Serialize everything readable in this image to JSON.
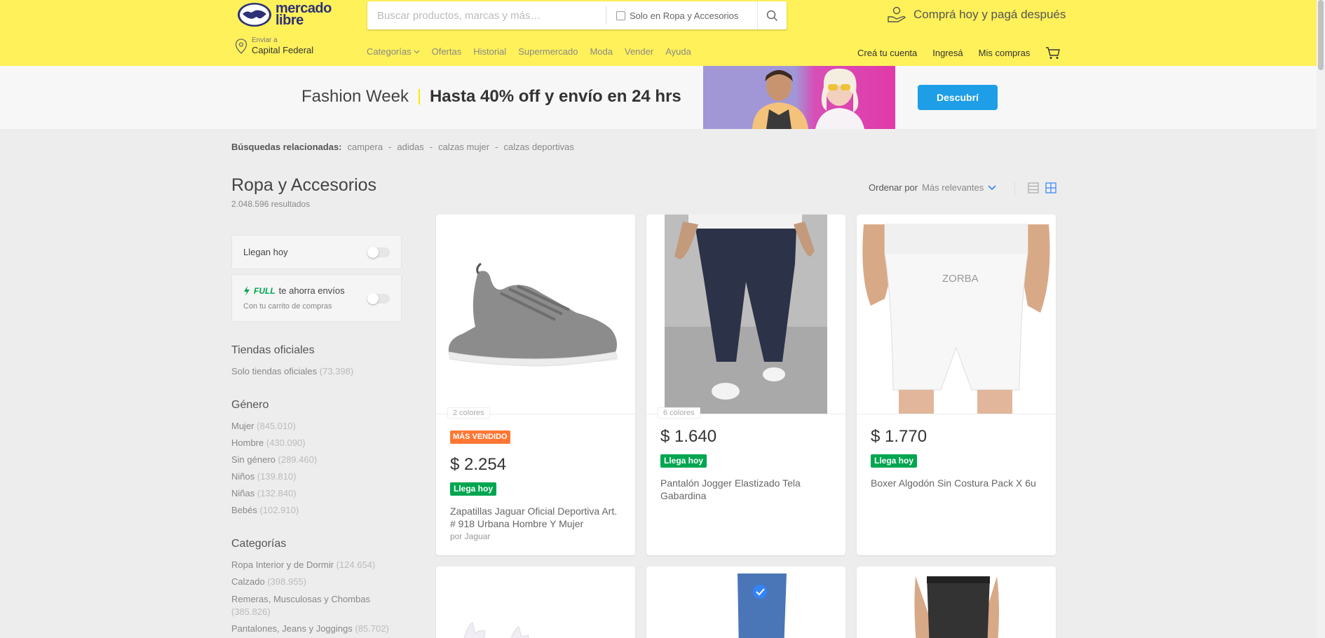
{
  "header": {
    "logo_line1": "mercado",
    "logo_line2": "libre",
    "search_placeholder": "Buscar productos, marcas y más…",
    "search_scope_label": "Solo en Ropa y Accesorios",
    "promo_text": "Comprá hoy y pagá después",
    "location_small": "Enviar a",
    "location_city": "Capital Federal",
    "nav": [
      "Categorías",
      "Ofertas",
      "Historial",
      "Supermercado",
      "Moda",
      "Vender",
      "Ayuda"
    ],
    "nav_right": [
      "Creá tu cuenta",
      "Ingresá",
      "Mis compras"
    ]
  },
  "banner": {
    "left_text": "Fashion Week",
    "strong_text": "Hasta 40% off y envío en 24 hrs",
    "button_label": "Descubrí"
  },
  "related": {
    "label": "Búsquedas relacionadas:",
    "items": [
      "campera",
      "adidas",
      "calzas mujer",
      "calzas deportivas"
    ]
  },
  "page": {
    "title": "Ropa y Accesorios",
    "results": "2.048.596 resultados",
    "sort_label": "Ordenar por",
    "sort_value": "Más relevantes"
  },
  "sidebar": {
    "toggle_today": "Llegan hoy",
    "full_brand": "FULL",
    "full_text": "te ahorra envíos",
    "full_sub": "Con tu carrito de compras",
    "official_title": "Tiendas oficiales",
    "official_item": "Solo tiendas oficiales",
    "official_count": "(73.398)",
    "gender_title": "Género",
    "gender": [
      {
        "label": "Mujer",
        "count": "(845.010)"
      },
      {
        "label": "Hombre",
        "count": "(430.090)"
      },
      {
        "label": "Sin género",
        "count": "(289.460)"
      },
      {
        "label": "Niños",
        "count": "(139.810)"
      },
      {
        "label": "Niñas",
        "count": "(132.840)"
      },
      {
        "label": "Bebés",
        "count": "(102.910)"
      }
    ],
    "categories_title": "Categorías",
    "categories": [
      {
        "label": "Ropa Interior y de Dormir",
        "count": "(124.654)"
      },
      {
        "label": "Calzado",
        "count": "(398.955)"
      },
      {
        "label": "Remeras, Musculosas y Chombas",
        "count": "(385.826)"
      },
      {
        "label": "Pantalones, Jeans y Joggings",
        "count": "(85.702)"
      }
    ]
  },
  "products": [
    {
      "colors": "2 colores",
      "badge": "MÁS VENDIDO",
      "price": "$ 2.254",
      "delivery": "Llega hoy",
      "title": "Zapatillas Jaguar Oficial Deportiva Art. # 918 Urbana Hombre Y Mujer",
      "seller": "por Jaguar"
    },
    {
      "colors": "6 colores",
      "price": "$ 1.640",
      "delivery": "Llega hoy",
      "title": "Pantalón Jogger Elastizado Tela Gabardina"
    },
    {
      "price": "$ 1.770",
      "delivery": "Llega hoy",
      "title": "Boxer Algodón Sin Costura Pack X 6u",
      "brand_print": "ZORBA"
    }
  ],
  "colors": {
    "header_yellow": "#fff159",
    "accent_blue": "#3483fa",
    "green_badge": "#00a650",
    "orange_badge": "#ff7733"
  }
}
